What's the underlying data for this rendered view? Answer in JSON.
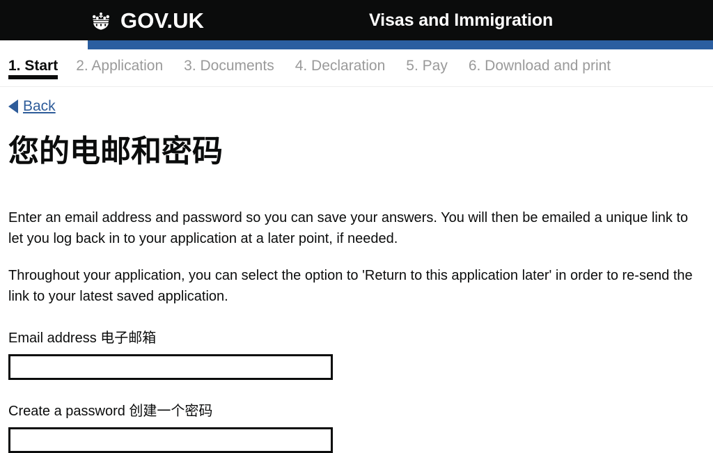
{
  "header": {
    "brand_name": "GOV.UK",
    "crown_icon": "crown-icon",
    "service_name": "Visas and Immigration",
    "background_color": "#0b0c0c",
    "phase_bar_color": "#2b5ea0"
  },
  "steps": [
    {
      "label": "1. Start",
      "active": true
    },
    {
      "label": "2. Application",
      "active": false
    },
    {
      "label": "3. Documents",
      "active": false
    },
    {
      "label": "4. Declaration",
      "active": false
    },
    {
      "label": "5. Pay",
      "active": false
    },
    {
      "label": "6. Download and print",
      "active": false
    }
  ],
  "back": {
    "label": "Back",
    "icon": "back-arrow-icon",
    "color": "#2e5c9a"
  },
  "main": {
    "title": "您的电邮和密码",
    "paragraph_1": "Enter an email address and password so you can save your answers. You will then be emailed a unique link to let you log back in to your application at a later point, if needed.",
    "paragraph_2": "Throughout your application, you can select the option to 'Return to this application later' in order to re-send the link to your latest saved application."
  },
  "form": {
    "email": {
      "label": "Email address 电子邮箱",
      "value": "",
      "placeholder": ""
    },
    "password": {
      "label": "Create a password 创建一个密码",
      "value": "",
      "placeholder": ""
    }
  }
}
